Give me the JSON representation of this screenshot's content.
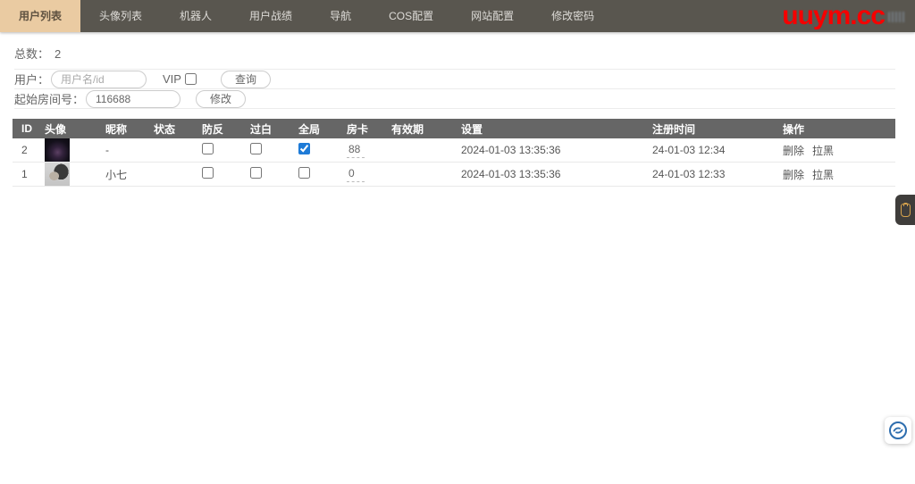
{
  "nav": {
    "tabs": [
      {
        "label": "用户列表",
        "active": true
      },
      {
        "label": "头像列表",
        "active": false
      },
      {
        "label": "机器人",
        "active": false
      },
      {
        "label": "用户战绩",
        "active": false
      },
      {
        "label": "导航",
        "active": false
      },
      {
        "label": "COS配置",
        "active": false
      },
      {
        "label": "网站配置",
        "active": false
      },
      {
        "label": "修改密码",
        "active": false
      }
    ],
    "logo": "uuym.cc"
  },
  "summary": {
    "total_label": "总数：",
    "total_value": "2"
  },
  "filters": {
    "user_label": "用户：",
    "user_placeholder": "用户名/id",
    "vip_label": "VIP",
    "vip_checked": false,
    "search_button": "查询",
    "room_label": "起始房间号：",
    "room_value": "116688",
    "modify_button": "修改"
  },
  "table": {
    "headers": [
      "ID",
      "头像",
      "昵称",
      "状态",
      "防反",
      "过白",
      "全局",
      "房卡",
      "有效期",
      "设置",
      "注册时间",
      "操作"
    ],
    "rows": [
      {
        "id": "2",
        "nickname": "-",
        "status": "",
        "fangfan": false,
        "guobai": false,
        "quanju": true,
        "fangka": "88",
        "validity": "",
        "settings": "2024-01-03 13:35:36",
        "reg_time": "24-01-03 12:34",
        "actions": {
          "delete": "删除",
          "blacklist": "拉黑"
        }
      },
      {
        "id": "1",
        "nickname": "小七",
        "status": "",
        "fangfan": false,
        "guobai": false,
        "quanju": false,
        "fangka": "0",
        "validity": "",
        "settings": "2024-01-03 13:35:36",
        "reg_time": "24-01-03 12:33",
        "actions": {
          "delete": "删除",
          "blacklist": "拉黑"
        }
      }
    ]
  },
  "colors": {
    "nav_bg": "#59564F",
    "active_tab_bg": "#EACBA2",
    "table_header_bg": "#666666",
    "logo_red": "#F60000",
    "checkbox_accent": "#1E7BD7"
  }
}
